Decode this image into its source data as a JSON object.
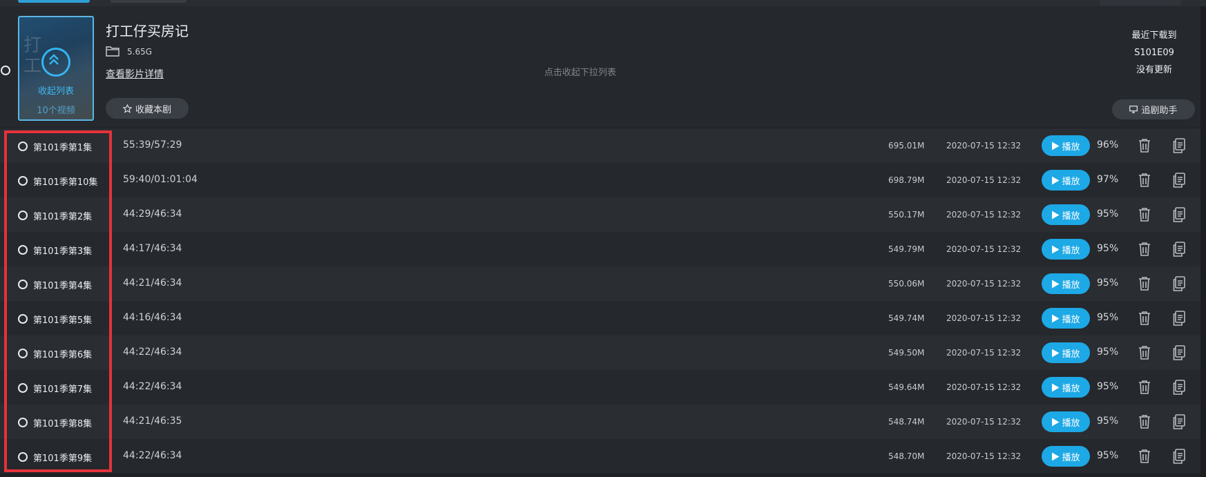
{
  "header": {
    "title": "打工仔买房记",
    "size": "5.65G",
    "details_link": "查看影片详情",
    "favorite_button": "收藏本剧",
    "collapse_hint": "点击收起下拉列表",
    "poster": {
      "collapse_label": "收起列表",
      "video_count": "10个视频"
    },
    "latest": {
      "label": "最近下载到",
      "episode": "S101E09",
      "update_status": "没有更新"
    },
    "helper_button": "追剧助手"
  },
  "play_label": "播放",
  "episodes": [
    {
      "name": "第101季第1集",
      "progress": "55:39/57:29",
      "size": "695.01M",
      "date": "2020-07-15 12:32",
      "percent": "96%"
    },
    {
      "name": "第101季第10集",
      "progress": "59:40/01:01:04",
      "size": "698.79M",
      "date": "2020-07-15 12:32",
      "percent": "97%"
    },
    {
      "name": "第101季第2集",
      "progress": "44:29/46:34",
      "size": "550.17M",
      "date": "2020-07-15 12:32",
      "percent": "95%"
    },
    {
      "name": "第101季第3集",
      "progress": "44:17/46:34",
      "size": "549.79M",
      "date": "2020-07-15 12:32",
      "percent": "95%"
    },
    {
      "name": "第101季第4集",
      "progress": "44:21/46:34",
      "size": "550.06M",
      "date": "2020-07-15 12:32",
      "percent": "95%"
    },
    {
      "name": "第101季第5集",
      "progress": "44:16/46:34",
      "size": "549.74M",
      "date": "2020-07-15 12:32",
      "percent": "95%"
    },
    {
      "name": "第101季第6集",
      "progress": "44:22/46:34",
      "size": "549.50M",
      "date": "2020-07-15 12:32",
      "percent": "95%"
    },
    {
      "name": "第101季第7集",
      "progress": "44:22/46:34",
      "size": "549.64M",
      "date": "2020-07-15 12:32",
      "percent": "95%"
    },
    {
      "name": "第101季第8集",
      "progress": "44:21/46:35",
      "size": "548.74M",
      "date": "2020-07-15 12:32",
      "percent": "95%"
    },
    {
      "name": "第101季第9集",
      "progress": "44:22/46:34",
      "size": "548.70M",
      "date": "2020-07-15 12:32",
      "percent": "95%"
    }
  ],
  "colors": {
    "accent": "#1da8e6",
    "highlight": "#e5333a",
    "background": "#1e2024"
  },
  "icons": {
    "folder": "folder-icon",
    "star": "star-icon",
    "monitor": "monitor-icon",
    "play": "play-icon",
    "trash": "trash-icon",
    "copy": "copy-icon",
    "collapse": "double-chevron-up-icon"
  }
}
